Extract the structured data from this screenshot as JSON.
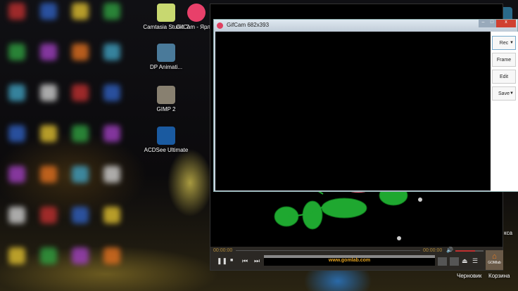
{
  "desktop": {
    "icons": [
      {
        "label": "Camtasia Studio 7",
        "color": "#c8d870"
      },
      {
        "label": "GifCam - Ярлык",
        "color": "#e8406a"
      },
      {
        "label": "DP Animati...",
        "color": "#4a7a9a"
      },
      {
        "label": "GIMP 2",
        "color": "#888070"
      },
      {
        "label": "ACDSee Ultimate",
        "color": "#1a5aa0"
      }
    ],
    "right_labels": {
      "partial": "кса",
      "draft": "Черновик",
      "trash": "Корзина"
    }
  },
  "gifcam": {
    "title": "GifCam 682x393",
    "buttons": {
      "rec": "Rec",
      "frame": "Frame",
      "edit": "Edit",
      "save": "Save"
    },
    "controls": {
      "minimize": "–",
      "maximize": "□",
      "close": "x"
    }
  },
  "player": {
    "time_current": "00:00:00",
    "time_total": "00:00:00",
    "banner": "www.gomlab.com",
    "brand": "GOMlab",
    "volume": 0.7,
    "progress": 0
  }
}
